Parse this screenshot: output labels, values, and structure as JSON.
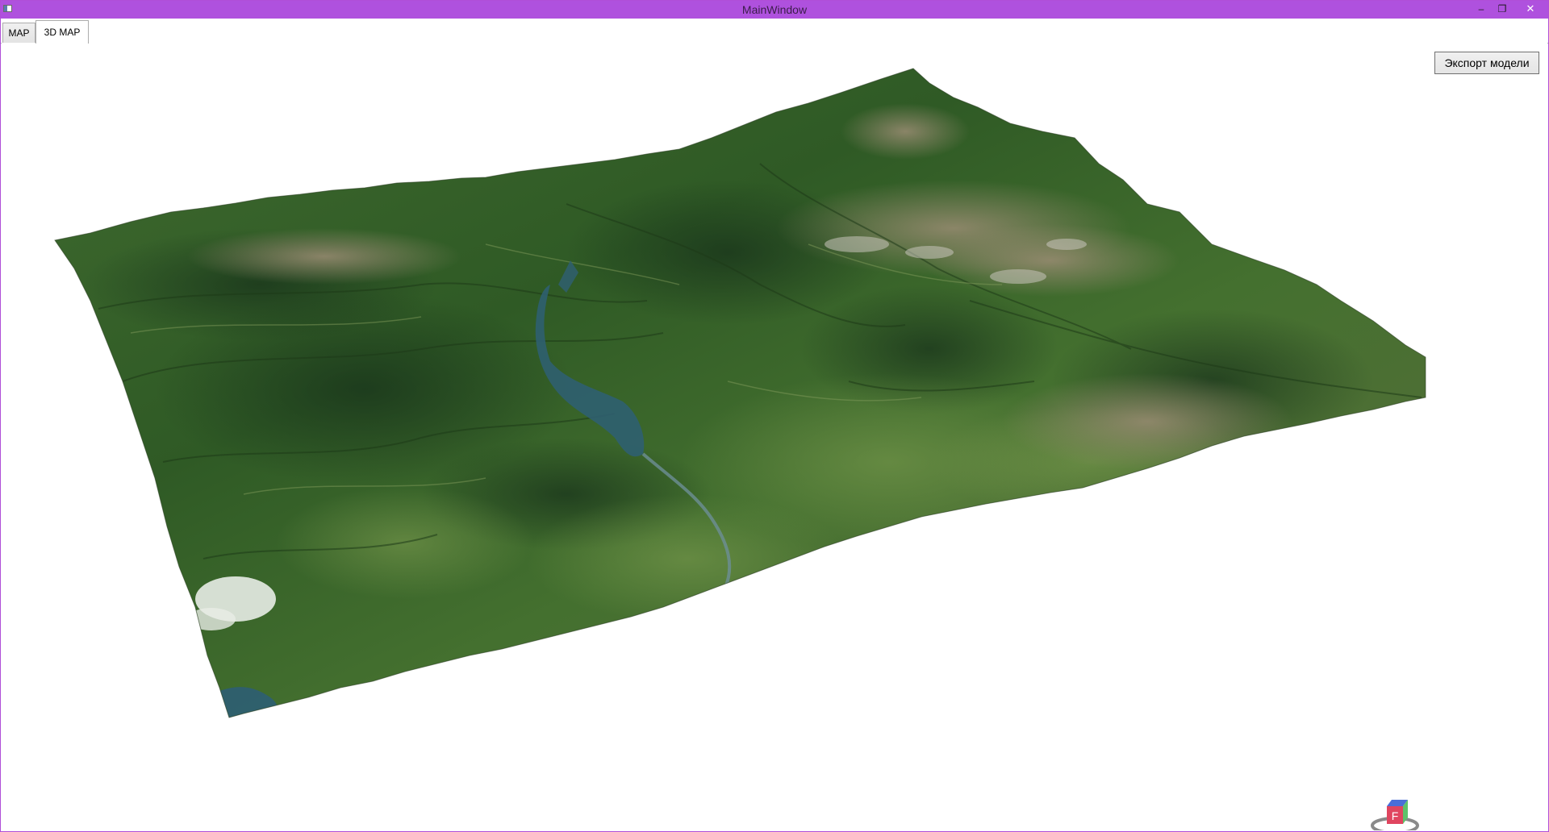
{
  "window": {
    "title": "MainWindow",
    "controls": {
      "minimize": "–",
      "restore": "❐",
      "close": "✕"
    }
  },
  "tabs": [
    {
      "label": "MAP",
      "active": false
    },
    {
      "label": "3D MAP",
      "active": true
    }
  ],
  "toolbar": {
    "export_label": "Экспорт модели"
  },
  "map": {
    "provider_logo": "bing",
    "terrain_colors": [
      "#2f5a24",
      "#3e6c2c",
      "#5a7d3b",
      "#8a8064",
      "#2f5d6b"
    ],
    "view_cube_face": "F",
    "view_cube_colors": {
      "front": "#e0455f",
      "top": "#4a6ed8",
      "side": "#5ec26a"
    }
  }
}
